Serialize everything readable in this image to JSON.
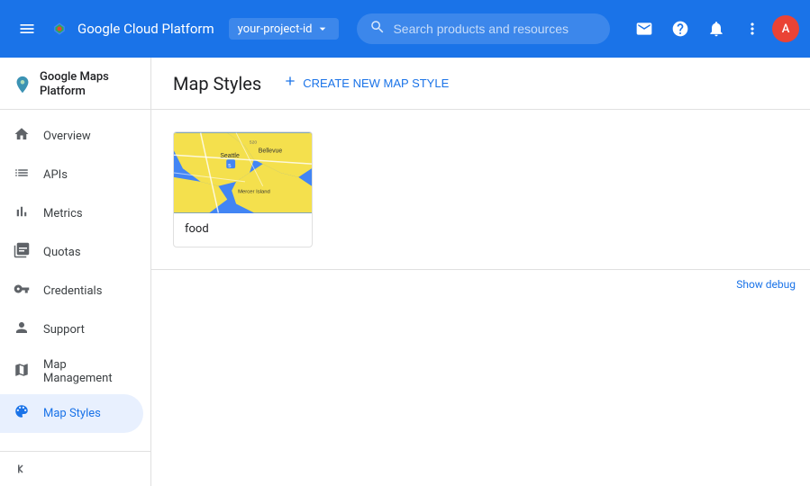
{
  "topbar": {
    "menu_icon": "☰",
    "app_title": "Google Cloud Platform",
    "project_name": "your-project-id",
    "search_placeholder": "Search products and resources",
    "icons": {
      "grid": "⊞",
      "email": "✉",
      "help": "?",
      "bell": "🔔",
      "more": "⋮"
    },
    "avatar_initials": "A"
  },
  "sidebar": {
    "logo_text": "Google Maps Platform",
    "nav_items": [
      {
        "id": "overview",
        "label": "Overview",
        "icon": "home"
      },
      {
        "id": "apis",
        "label": "APIs",
        "icon": "list"
      },
      {
        "id": "metrics",
        "label": "Metrics",
        "icon": "bar_chart"
      },
      {
        "id": "quotas",
        "label": "Quotas",
        "icon": "crop_square"
      },
      {
        "id": "credentials",
        "label": "Credentials",
        "icon": "vpn_key"
      },
      {
        "id": "support",
        "label": "Support",
        "icon": "person"
      },
      {
        "id": "map-management",
        "label": "Map Management",
        "icon": "map"
      },
      {
        "id": "map-styles",
        "label": "Map Styles",
        "icon": "palette",
        "active": true
      }
    ],
    "collapse_icon": "«"
  },
  "content": {
    "page_title": "Map Styles",
    "create_button_label": "CREATE NEW MAP STYLE",
    "map_style_cards": [
      {
        "id": "food",
        "name": "food",
        "thumbnail_type": "seattle_map"
      }
    ],
    "bottom_bar": {
      "show_debug_label": "Show debug"
    }
  }
}
